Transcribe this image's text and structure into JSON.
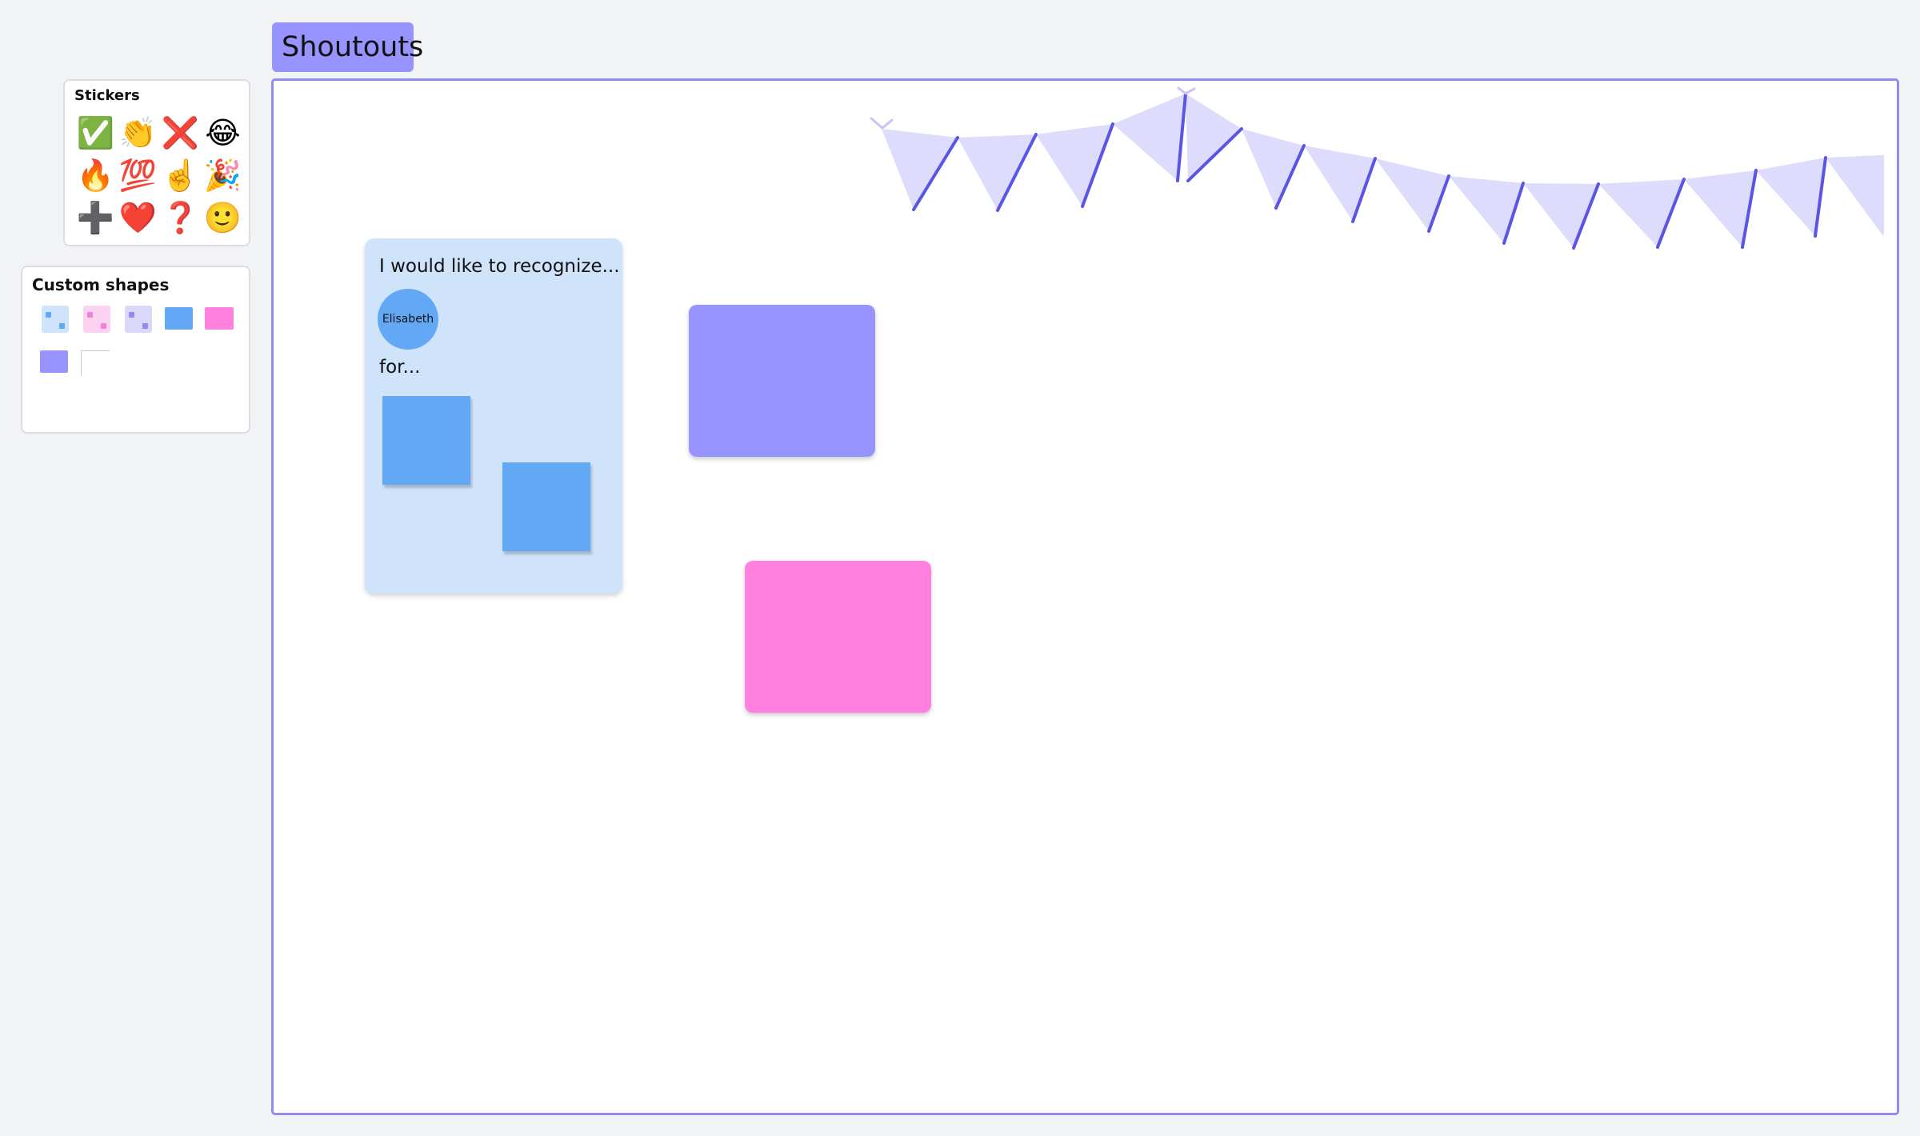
{
  "section": {
    "title": "Shoutouts"
  },
  "stickers_panel": {
    "title": "Stickers",
    "items": [
      {
        "icon": "check-mark-icon",
        "glyph": "✅"
      },
      {
        "icon": "clapping-hands-icon",
        "glyph": "👏"
      },
      {
        "icon": "cross-mark-icon",
        "glyph": "❌"
      },
      {
        "icon": "tears-of-joy-icon",
        "glyph": "😂"
      },
      {
        "icon": "fire-icon",
        "glyph": "🔥"
      },
      {
        "icon": "hundred-points-icon",
        "glyph": "💯"
      },
      {
        "icon": "pointing-up-icon",
        "glyph": "☝️"
      },
      {
        "icon": "party-popper-icon",
        "glyph": "🎉"
      },
      {
        "icon": "plus-icon",
        "glyph": "➕"
      },
      {
        "icon": "heart-icon",
        "glyph": "❤️"
      },
      {
        "icon": "question-mark-icon",
        "glyph": "❓"
      },
      {
        "icon": "smiling-face-icon",
        "glyph": "🙂"
      }
    ]
  },
  "shapes_panel": {
    "title": "Custom shapes"
  },
  "recognition_card": {
    "heading": "I would like to recognize...",
    "person": "Elisabeth",
    "for_label": "for..."
  },
  "colors": {
    "frame_border": "#8f8bf0",
    "title_bg": "#9793ff",
    "card_bg": "#cfe3fb",
    "sticky_blue": "#62a8f5",
    "sticky_purple": "#9793ff",
    "sticky_pink": "#ff80de",
    "bunting_fill": "#dddcfd",
    "bunting_edge": "#5b55e6"
  }
}
